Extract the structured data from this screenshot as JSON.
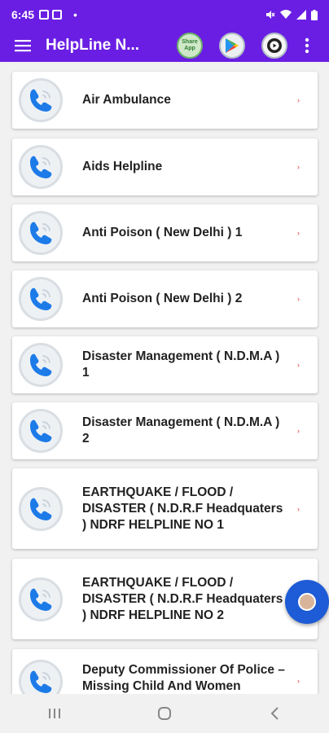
{
  "status_bar": {
    "time": "6:45",
    "dot": "•"
  },
  "app_bar": {
    "title": "HelpLine N...",
    "share_text": "Share App"
  },
  "items": [
    {
      "label": "Air Ambulance"
    },
    {
      "label": "Aids Helpline"
    },
    {
      "label": "Anti Poison ( New Delhi ) 1"
    },
    {
      "label": "Anti Poison ( New Delhi ) 2"
    },
    {
      "label": "Disaster Management ( N.D.M.A ) 1"
    },
    {
      "label": "Disaster Management ( N.D.M.A ) 2"
    },
    {
      "label": "EARTHQUAKE / FLOOD / DISASTER ( N.D.R.F Headquaters ) NDRF HELPLINE NO 1"
    },
    {
      "label": "EARTHQUAKE / FLOOD / DISASTER ( N.D.R.F Headquaters ) NDRF HELPLINE NO 2"
    },
    {
      "label": "Deputy Commissioner Of Police – Missing Child And Women"
    }
  ],
  "colors": {
    "primary": "#6a1ee3",
    "fab": "#1e5bd6",
    "arrow": "#e53935",
    "phone_icon": "#1d7be8"
  },
  "icons": {
    "menu": "hamburger-icon",
    "share": "share-app-icon",
    "store": "play-store-icon",
    "video": "video-icon",
    "more": "more-vert-icon",
    "phone": "phone-call-icon"
  }
}
